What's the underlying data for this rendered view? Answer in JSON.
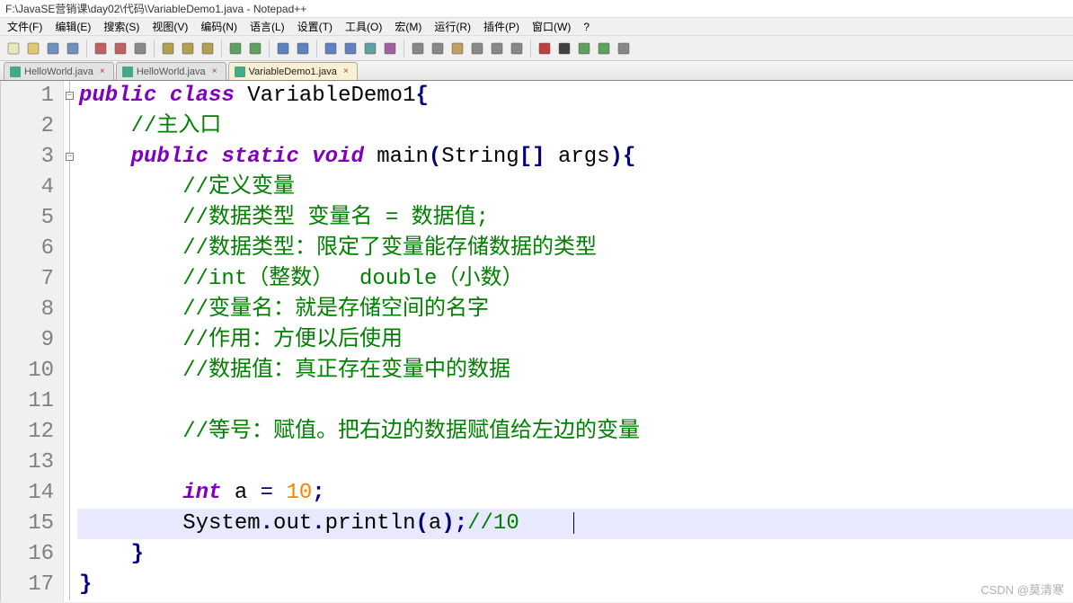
{
  "window": {
    "title": "F:\\JavaSE营销课\\day02\\代码\\VariableDemo1.java - Notepad++"
  },
  "menu": {
    "items": [
      "文件(F)",
      "编辑(E)",
      "搜索(S)",
      "视图(V)",
      "编码(N)",
      "语言(L)",
      "设置(T)",
      "工具(O)",
      "宏(M)",
      "运行(R)",
      "插件(P)",
      "窗口(W)",
      "?"
    ]
  },
  "tabs": [
    {
      "label": "HelloWorld.java",
      "active": false
    },
    {
      "label": "HelloWorld.java",
      "active": false
    },
    {
      "label": "VariableDemo1.java",
      "active": true
    }
  ],
  "watermark": "CSDN @莫清寒",
  "code": {
    "lines": [
      {
        "n": 1,
        "fold": "open",
        "tokens": [
          [
            "kw",
            "public"
          ],
          [
            "sp",
            " "
          ],
          [
            "kw",
            "class"
          ],
          [
            "sp",
            " "
          ],
          [
            "cls",
            "VariableDemo1"
          ],
          [
            "pun",
            "{"
          ]
        ]
      },
      {
        "n": 2,
        "tokens": [
          [
            "indent",
            "    "
          ],
          [
            "com",
            "//主入口"
          ]
        ]
      },
      {
        "n": 3,
        "fold": "open",
        "tokens": [
          [
            "indent",
            "    "
          ],
          [
            "kw",
            "public"
          ],
          [
            "sp",
            " "
          ],
          [
            "kw",
            "static"
          ],
          [
            "sp",
            " "
          ],
          [
            "kw",
            "void"
          ],
          [
            "sp",
            " "
          ],
          [
            "ident",
            "main"
          ],
          [
            "pun",
            "("
          ],
          [
            "cls",
            "String"
          ],
          [
            "pun",
            "[]"
          ],
          [
            "sp",
            " "
          ],
          [
            "ident",
            "args"
          ],
          [
            "pun",
            ")"
          ],
          [
            "pun",
            "{"
          ]
        ]
      },
      {
        "n": 4,
        "tokens": [
          [
            "indent",
            "        "
          ],
          [
            "com",
            "//定义变量"
          ]
        ]
      },
      {
        "n": 5,
        "tokens": [
          [
            "indent",
            "        "
          ],
          [
            "com",
            "//数据类型 变量名 = 数据值;"
          ]
        ]
      },
      {
        "n": 6,
        "tokens": [
          [
            "indent",
            "        "
          ],
          [
            "com",
            "//数据类型：限定了变量能存储数据的类型"
          ]
        ]
      },
      {
        "n": 7,
        "tokens": [
          [
            "indent",
            "        "
          ],
          [
            "com",
            "//int（整数）  double（小数）"
          ]
        ]
      },
      {
        "n": 8,
        "tokens": [
          [
            "indent",
            "        "
          ],
          [
            "com",
            "//变量名：就是存储空间的名字"
          ]
        ]
      },
      {
        "n": 9,
        "tokens": [
          [
            "indent",
            "        "
          ],
          [
            "com",
            "//作用：方便以后使用"
          ]
        ]
      },
      {
        "n": 10,
        "tokens": [
          [
            "indent",
            "        "
          ],
          [
            "com",
            "//数据值：真正存在变量中的数据"
          ]
        ]
      },
      {
        "n": 11,
        "tokens": []
      },
      {
        "n": 12,
        "tokens": [
          [
            "indent",
            "        "
          ],
          [
            "com",
            "//等号：赋值。把右边的数据赋值给左边的变量"
          ]
        ]
      },
      {
        "n": 13,
        "tokens": []
      },
      {
        "n": 14,
        "tokens": [
          [
            "indent",
            "        "
          ],
          [
            "kw",
            "int"
          ],
          [
            "sp",
            " "
          ],
          [
            "ident",
            "a"
          ],
          [
            "sp",
            " "
          ],
          [
            "op",
            "="
          ],
          [
            "sp",
            " "
          ],
          [
            "num",
            "10"
          ],
          [
            "pun",
            ";"
          ]
        ]
      },
      {
        "n": 15,
        "hl": true,
        "cursor": true,
        "tokens": [
          [
            "indent",
            "        "
          ],
          [
            "cls",
            "System"
          ],
          [
            "pun",
            "."
          ],
          [
            "ident",
            "out"
          ],
          [
            "pun",
            "."
          ],
          [
            "ident",
            "println"
          ],
          [
            "pun",
            "("
          ],
          [
            "ident",
            "a"
          ],
          [
            "pun",
            ")"
          ],
          [
            "pun",
            ";"
          ],
          [
            "com",
            "//10"
          ]
        ]
      },
      {
        "n": 16,
        "tokens": [
          [
            "indent",
            "    "
          ],
          [
            "pun",
            "}"
          ]
        ]
      },
      {
        "n": 17,
        "tokens": [
          [
            "pun",
            "}"
          ]
        ]
      }
    ]
  },
  "toolbar_icons": [
    "new-file-icon",
    "open-file-icon",
    "save-icon",
    "save-all-icon",
    "close-icon",
    "close-all-icon",
    "print-icon",
    "cut-icon",
    "copy-icon",
    "paste-icon",
    "undo-icon",
    "redo-icon",
    "find-icon",
    "replace-icon",
    "zoom-in-icon",
    "zoom-out-icon",
    "sync-icon",
    "word-wrap-icon",
    "show-all-icon",
    "indent-guide-icon",
    "folder-icon",
    "doc-map-icon",
    "func-list-icon",
    "monitor-icon",
    "record-icon",
    "stop-icon",
    "play-icon",
    "play-multi-icon",
    "save-macro-icon"
  ]
}
